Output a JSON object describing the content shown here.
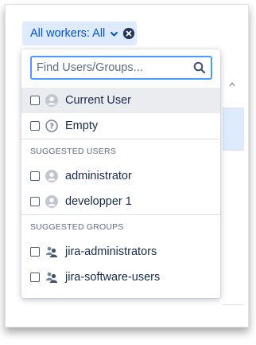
{
  "filter": {
    "label": "All workers: All",
    "chevron_icon": "chevron-down-icon",
    "clear_icon": "clear-icon"
  },
  "search": {
    "placeholder": "Find Users/Groups...",
    "value": ""
  },
  "options": [
    {
      "label": "Current User",
      "icon": "user-avatar-icon",
      "checked": false,
      "highlighted": true
    },
    {
      "label": "Empty",
      "icon": "question-avatar-icon",
      "checked": false,
      "highlighted": false
    }
  ],
  "suggested_users": {
    "heading": "SUGGESTED USERS",
    "items": [
      {
        "label": "administrator",
        "icon": "user-avatar-icon",
        "checked": false
      },
      {
        "label": "developper 1",
        "icon": "user-avatar-icon",
        "checked": false
      }
    ]
  },
  "suggested_groups": {
    "heading": "SUGGESTED GROUPS",
    "items": [
      {
        "label": "jira-administrators",
        "icon": "group-icon",
        "checked": false
      },
      {
        "label": "jira-software-users",
        "icon": "group-icon",
        "checked": false
      }
    ]
  },
  "colors": {
    "pill_bg": "#deebff",
    "pill_text": "#0052cc",
    "focus_border": "#4c9aff",
    "highlight_bg": "#ebecf0"
  }
}
